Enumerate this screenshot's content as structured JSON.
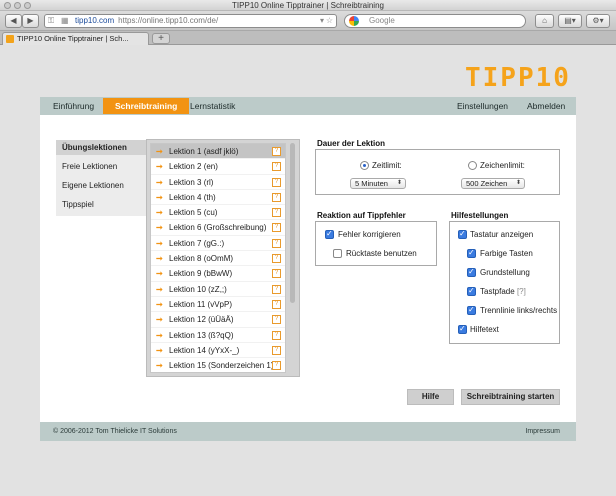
{
  "window": {
    "title": "TIPP10 Online Tipptrainer | Schreibtraining"
  },
  "toolbar": {
    "host": "tipp10.com",
    "url": "https://online.tipp10.com/de/",
    "search_placeholder": "Google",
    "back": "◀",
    "forward": "▶",
    "plus": "+"
  },
  "tab": {
    "title": "TIPP10 Online Tipptrainer | Sch...",
    "new_tab": "+"
  },
  "logo": "TIPP10",
  "nav": {
    "items": [
      "Einführung",
      "Schreibtraining",
      "Lernstatistik"
    ],
    "right": [
      "Einstellungen",
      "Abmelden"
    ]
  },
  "sidebar": {
    "items": [
      "Übungslektionen",
      "Freie Lektionen",
      "Eigene Lektionen",
      "Tippspiel"
    ]
  },
  "lessons": [
    "Lektion 1 (asdf jklö)",
    "Lektion 2 (en)",
    "Lektion 3 (rl)",
    "Lektion 4 (th)",
    "Lektion 5 (cu)",
    "Lektion 6 (Großschreibung)",
    "Lektion 7 (gG.:)",
    "Lektion 8 (oOmM)",
    "Lektion 9 (bBwW)",
    "Lektion 10 (zZ,;)",
    "Lektion 11 (vVpP)",
    "Lektion 12 (üÜäÄ)",
    "Lektion 13 (ß?qQ)",
    "Lektion 14 (yYxX-_)",
    "Lektion 15 (Sonderzeichen 1)"
  ],
  "lesson_help": "?",
  "duration": {
    "title": "Dauer der Lektion",
    "timelimit": "Zeitlimit:",
    "charlimit": "Zeichenlimit:",
    "time_value": "5 Minuten",
    "char_value": "500 Zeichen"
  },
  "reaction": {
    "title": "Reaktion auf Tippfehler",
    "correct": "Fehler korrigieren",
    "backspace": "Rücktaste benutzen"
  },
  "help": {
    "title": "Hilfestellungen",
    "keyboard": "Tastatur anzeigen",
    "colored": "Farbige Tasten",
    "home": "Grundstellung",
    "paths": "Tastpfade",
    "paths_tip": "[?]",
    "divider": "Trennlinie links/rechts",
    "helptext": "Hilfetext"
  },
  "buttons": {
    "help": "Hilfe",
    "start": "Schreibtraining starten"
  },
  "footer": {
    "copyright": "© 2006-2012 Tom Thielicke IT Solutions",
    "imprint": "Impressum"
  },
  "colors": {
    "accent": "#f29312",
    "nav_bg": "#bccbc9",
    "logo": "#f5a31b"
  }
}
